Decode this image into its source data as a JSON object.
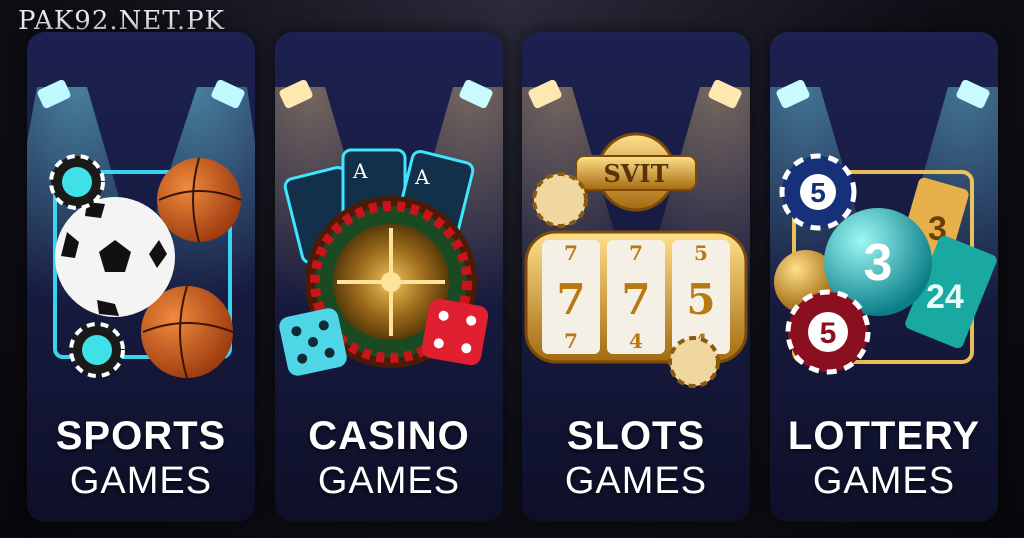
{
  "watermark": "PAK92.NET.PK",
  "cards": [
    {
      "title": "SPORTS",
      "subtitle": "GAMES",
      "light_color": "#7ff3ff",
      "icon": "sports-balls-icon"
    },
    {
      "title": "CASINO",
      "subtitle": "GAMES",
      "light_color": "#ffd27a",
      "icon": "roulette-cards-dice-icon"
    },
    {
      "title": "SLOTS",
      "subtitle": "GAMES",
      "light_color": "#ffd27a",
      "icon": "slot-machine-icon"
    },
    {
      "title": "LOTTERY",
      "subtitle": "GAMES",
      "light_color": "#7ff3ff",
      "icon": "lottery-balls-tickets-icon"
    }
  ],
  "art_text": {
    "slots_sign": "SVIT",
    "reel_top": [
      "7",
      "7",
      "5"
    ],
    "reel_mid": [
      "7",
      "7",
      "5"
    ],
    "reel_bot": [
      "7",
      "4",
      "4"
    ],
    "lottery_big_ball": "3",
    "lottery_chip_top": "5",
    "lottery_chip_bottom": "5",
    "lottery_ticket_a": "3",
    "lottery_ticket_b": "24",
    "casino_card_letter": "A"
  }
}
